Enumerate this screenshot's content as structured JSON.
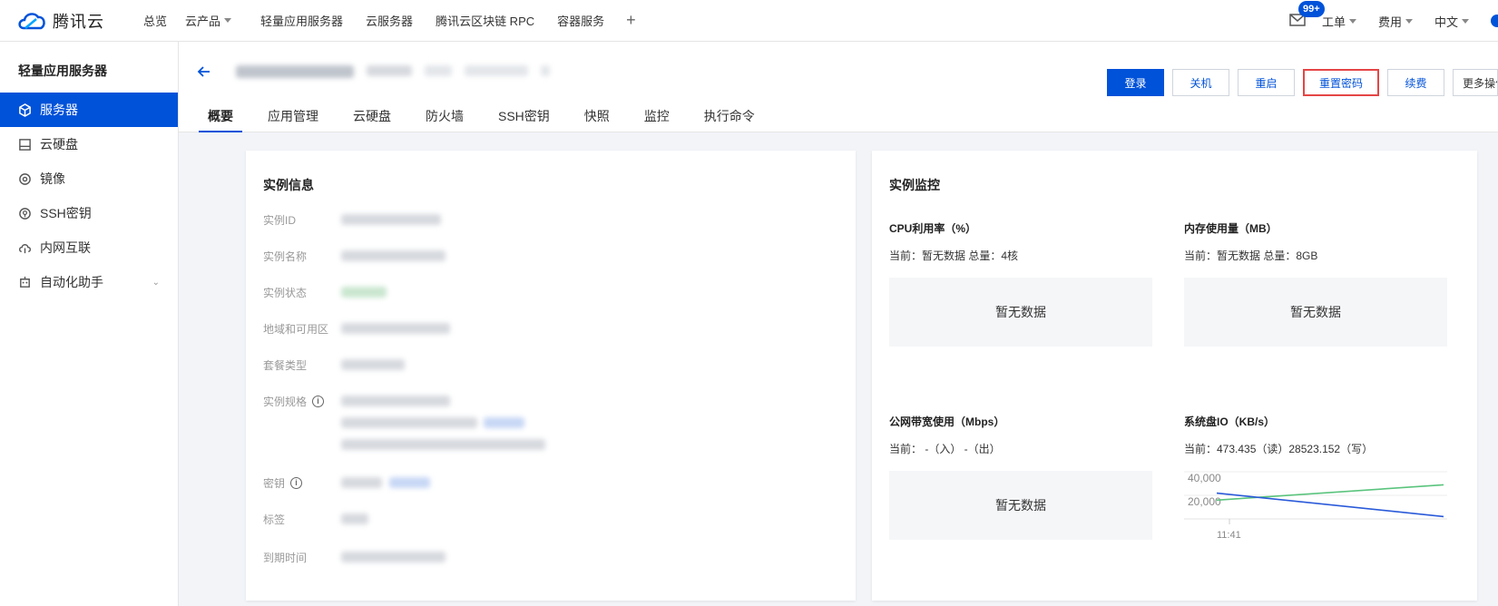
{
  "topnav": {
    "logo_text": "腾讯云",
    "items": [
      "总览",
      "云产品",
      "轻量应用服务器",
      "云服务器",
      "腾讯云区块链 RPC",
      "容器服务"
    ],
    "plus": "+",
    "badge": "99+",
    "right_items": [
      "工单",
      "费用",
      "中文"
    ]
  },
  "sidebar": {
    "title": "轻量应用服务器",
    "items": [
      {
        "label": "服务器",
        "icon": "cube-icon"
      },
      {
        "label": "云硬盘",
        "icon": "disk-icon"
      },
      {
        "label": "镜像",
        "icon": "image-icon"
      },
      {
        "label": "SSH密钥",
        "icon": "key-icon"
      },
      {
        "label": "内网互联",
        "icon": "network-icon"
      },
      {
        "label": "自动化助手",
        "icon": "robot-icon"
      }
    ]
  },
  "header": {
    "buttons": [
      "登录",
      "关机",
      "重启",
      "重置密码",
      "续费",
      "更多操作"
    ],
    "tabs": [
      "概要",
      "应用管理",
      "云硬盘",
      "防火墙",
      "SSH密钥",
      "快照",
      "监控",
      "执行命令"
    ]
  },
  "instance_info": {
    "title": "实例信息",
    "labels": [
      "实例ID",
      "实例名称",
      "实例状态",
      "地域和可用区",
      "套餐类型",
      "实例规格",
      "密钥",
      "标签",
      "到期时间"
    ],
    "info_icon": "i"
  },
  "monitor": {
    "title": "实例监控",
    "cpu_title": "CPU利用率（%）",
    "cpu_sub": "当前：暂无数据 总量：4核",
    "mem_title": "内存使用量（MB）",
    "mem_sub": "当前：暂无数据 总量：8GB",
    "bw_title": "公网带宽使用（Mbps）",
    "bw_sub": "当前： -（入） -（出）",
    "io_title": "系统盘IO（KB/s）",
    "io_sub": "当前：473.435（读）28523.152（写）",
    "nodata": "暂无数据"
  },
  "chart_data": {
    "type": "line",
    "x": [
      "11:41"
    ],
    "yticks": [
      "40,000",
      "20,000"
    ],
    "ylim": [
      0,
      45000
    ],
    "series": [
      {
        "color": "#5ac47d",
        "values": [
          16000,
          29000
        ]
      },
      {
        "color": "#2a5ad9",
        "values": [
          22000,
          2000
        ]
      }
    ]
  },
  "colors": {
    "primary": "#0052d9",
    "danger": "#e54545"
  }
}
